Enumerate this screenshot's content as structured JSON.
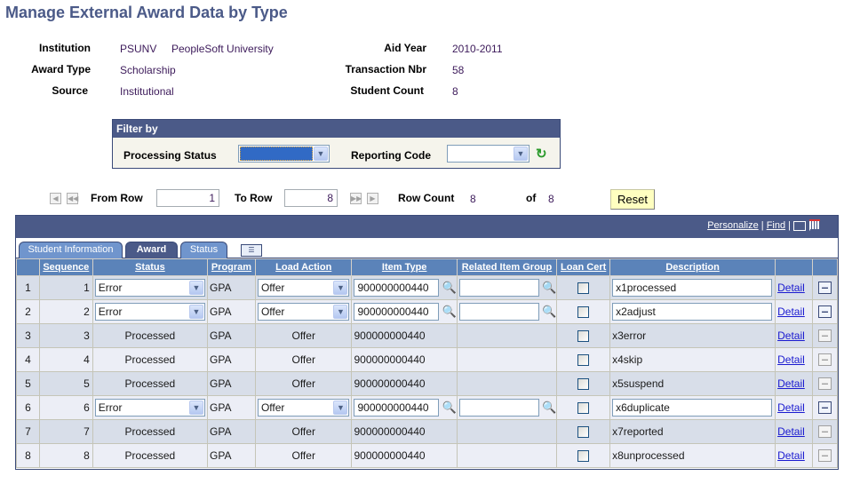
{
  "page": {
    "title": "Manage External Award Data by Type"
  },
  "header": {
    "institution_label": "Institution",
    "institution_code": "PSUNV",
    "institution_name": "PeopleSoft University",
    "award_type_label": "Award Type",
    "award_type": "Scholarship",
    "source_label": "Source",
    "source": "Institutional",
    "aid_year_label": "Aid Year",
    "aid_year": "2010-2011",
    "transaction_nbr_label": "Transaction Nbr",
    "transaction_nbr": "58",
    "student_count_label": "Student Count",
    "student_count": "8"
  },
  "filter": {
    "title": "Filter by",
    "processing_status_label": "Processing Status",
    "processing_status_value": "",
    "reporting_code_label": "Reporting Code",
    "reporting_code_value": "",
    "refresh_icon": "refresh-icon"
  },
  "navigation": {
    "from_row_label": "From Row",
    "from_row_value": "1",
    "to_row_label": "To Row",
    "to_row_value": "8",
    "row_count_label": "Row Count",
    "row_count_value": "8",
    "of_label": "of",
    "of_value": "8",
    "reset_label": "Reset"
  },
  "grid": {
    "personalize_label": "Personalize",
    "find_label": "Find",
    "separator": "|",
    "tabs": [
      {
        "label": "Student Information",
        "active": false
      },
      {
        "label": "Award",
        "active": true
      },
      {
        "label": "Status",
        "active": false
      }
    ],
    "columns": [
      "",
      "Sequence",
      "Status",
      "Program",
      "Load Action",
      "Item Type",
      "Related Item Group",
      "Loan Cert",
      "Description",
      "",
      ""
    ],
    "detail_label": "Detail",
    "rows": [
      {
        "num": "1",
        "sequence": "1",
        "status": "Error",
        "program": "GPA",
        "load_action": "Offer",
        "item_type": "900000000440",
        "related_item_group": "",
        "loan_cert": false,
        "description": "x1processed",
        "editable": true
      },
      {
        "num": "2",
        "sequence": "2",
        "status": "Error",
        "program": "GPA",
        "load_action": "Offer",
        "item_type": "900000000440",
        "related_item_group": "",
        "loan_cert": false,
        "description": "x2adjust",
        "editable": true
      },
      {
        "num": "3",
        "sequence": "3",
        "status": "Processed",
        "program": "GPA",
        "load_action": "Offer",
        "item_type": "900000000440",
        "related_item_group": "",
        "loan_cert": false,
        "description": "x3error",
        "editable": false
      },
      {
        "num": "4",
        "sequence": "4",
        "status": "Processed",
        "program": "GPA",
        "load_action": "Offer",
        "item_type": "900000000440",
        "related_item_group": "",
        "loan_cert": false,
        "description": "x4skip",
        "editable": false
      },
      {
        "num": "5",
        "sequence": "5",
        "status": "Processed",
        "program": "GPA",
        "load_action": "Offer",
        "item_type": "900000000440",
        "related_item_group": "",
        "loan_cert": false,
        "description": "x5suspend",
        "editable": false
      },
      {
        "num": "6",
        "sequence": "6",
        "status": "Error",
        "program": "GPA",
        "load_action": "Offer",
        "item_type": "900000000440",
        "related_item_group": "",
        "loan_cert": false,
        "description": "x6duplicate",
        "editable": true
      },
      {
        "num": "7",
        "sequence": "7",
        "status": "Processed",
        "program": "GPA",
        "load_action": "Offer",
        "item_type": "900000000440",
        "related_item_group": "",
        "loan_cert": false,
        "description": "x7reported",
        "editable": false
      },
      {
        "num": "8",
        "sequence": "8",
        "status": "Processed",
        "program": "GPA",
        "load_action": "Offer",
        "item_type": "900000000440",
        "related_item_group": "",
        "loan_cert": false,
        "description": "x8unprocessed",
        "editable": false
      }
    ]
  },
  "colors": {
    "header_bar": "#4b5a88",
    "column_header": "#5b83b9",
    "row_odd": "#d8dee9",
    "row_even": "#eceef6",
    "reset_button": "#ffffc0",
    "title_text": "#4b5a88"
  }
}
